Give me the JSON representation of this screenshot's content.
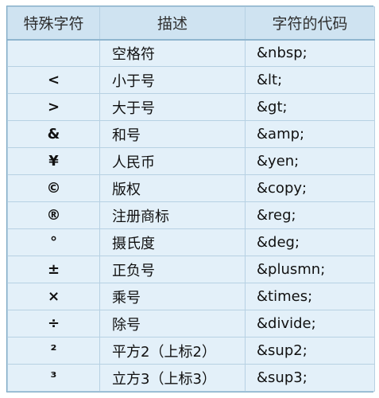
{
  "header": {
    "col_char": "特殊字符",
    "col_desc": "描述",
    "col_code": "字符的代码"
  },
  "rows": [
    {
      "char": "",
      "desc": "空格符",
      "code": "&nbsp;"
    },
    {
      "char": "<",
      "desc": "小于号",
      "code": "&lt;"
    },
    {
      "char": ">",
      "desc": "大于号",
      "code": "&gt;"
    },
    {
      "char": "&",
      "desc": "和号",
      "code": "&amp;"
    },
    {
      "char": "¥",
      "desc": "人民币",
      "code": "&yen;"
    },
    {
      "char": "©",
      "desc": "版权",
      "code": "&copy;"
    },
    {
      "char": "®",
      "desc": "注册商标",
      "code": "&reg;"
    },
    {
      "char": "°",
      "desc": "摄氏度",
      "code": "&deg;"
    },
    {
      "char": "±",
      "desc": "正负号",
      "code": "&plusmn;"
    },
    {
      "char": "×",
      "desc": "乘号",
      "code": "&times;"
    },
    {
      "char": "÷",
      "desc": "除号",
      "code": "&divide;"
    },
    {
      "char": "²",
      "desc": "平方2（上标2）",
      "code": "&sup2;"
    },
    {
      "char": "³",
      "desc": "立方3（上标3）",
      "code": "&sup3;"
    }
  ]
}
